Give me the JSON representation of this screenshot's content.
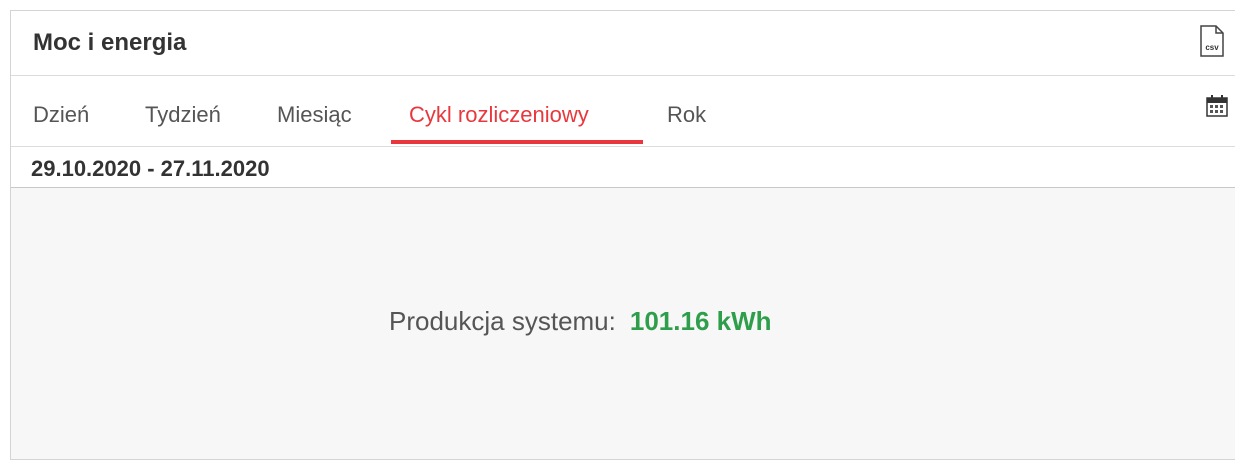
{
  "panel": {
    "title": "Moc i energia",
    "csv_label": "csv"
  },
  "tabs": [
    {
      "label": "Dzień",
      "active": false
    },
    {
      "label": "Tydzień",
      "active": false
    },
    {
      "label": "Miesiąc",
      "active": false
    },
    {
      "label": "Cykl rozliczeniowy",
      "active": true
    },
    {
      "label": "Rok",
      "active": false
    }
  ],
  "date_range": "29.10.2020 - 27.11.2020",
  "production": {
    "label": "Produkcja systemu:",
    "value": "101.16 kWh"
  },
  "colors": {
    "accent": "#e8383d",
    "value_green": "#2e9e4a",
    "content_bg": "#f7f7f7"
  }
}
